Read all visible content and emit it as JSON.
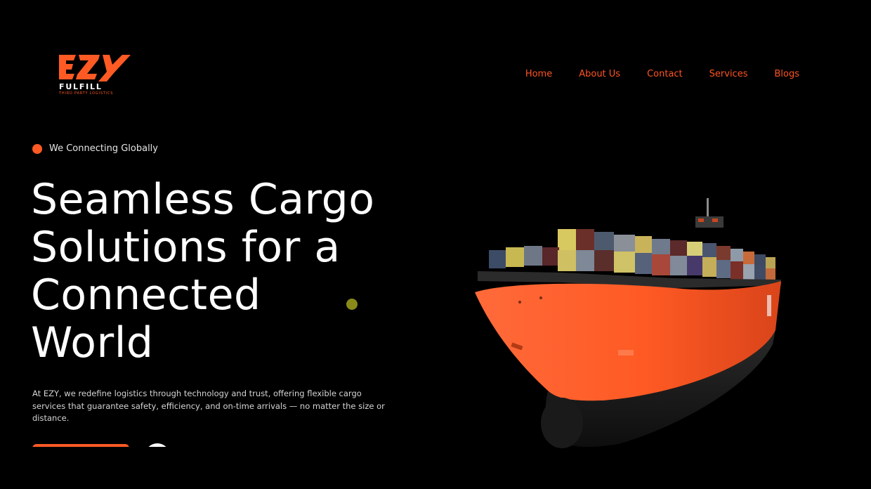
{
  "brand": {
    "name": "FULFILL",
    "tagline": "THIRD PARTY LOGISTICS",
    "logo_letters": "EZY",
    "accent_color": "#ff5a24"
  },
  "nav": {
    "items": [
      {
        "label": "Home"
      },
      {
        "label": "About Us"
      },
      {
        "label": "Contact"
      },
      {
        "label": "Services"
      },
      {
        "label": "Blogs"
      }
    ]
  },
  "hero": {
    "eyebrow": "We Connecting Globally",
    "headline_lines": [
      "Seamless Cargo",
      "Solutions for a",
      "Connected",
      "World"
    ],
    "description": "At EZY, we redefine logistics through technology and trust, offering flexible cargo services that guarantee safety, efficiency, and on-time arrivals — no matter the size or distance."
  },
  "icons": {
    "eyebrow_dot": "orange-dot-icon",
    "decor_dot": "olive-dot-icon",
    "ship": "cargo-ship-image"
  }
}
